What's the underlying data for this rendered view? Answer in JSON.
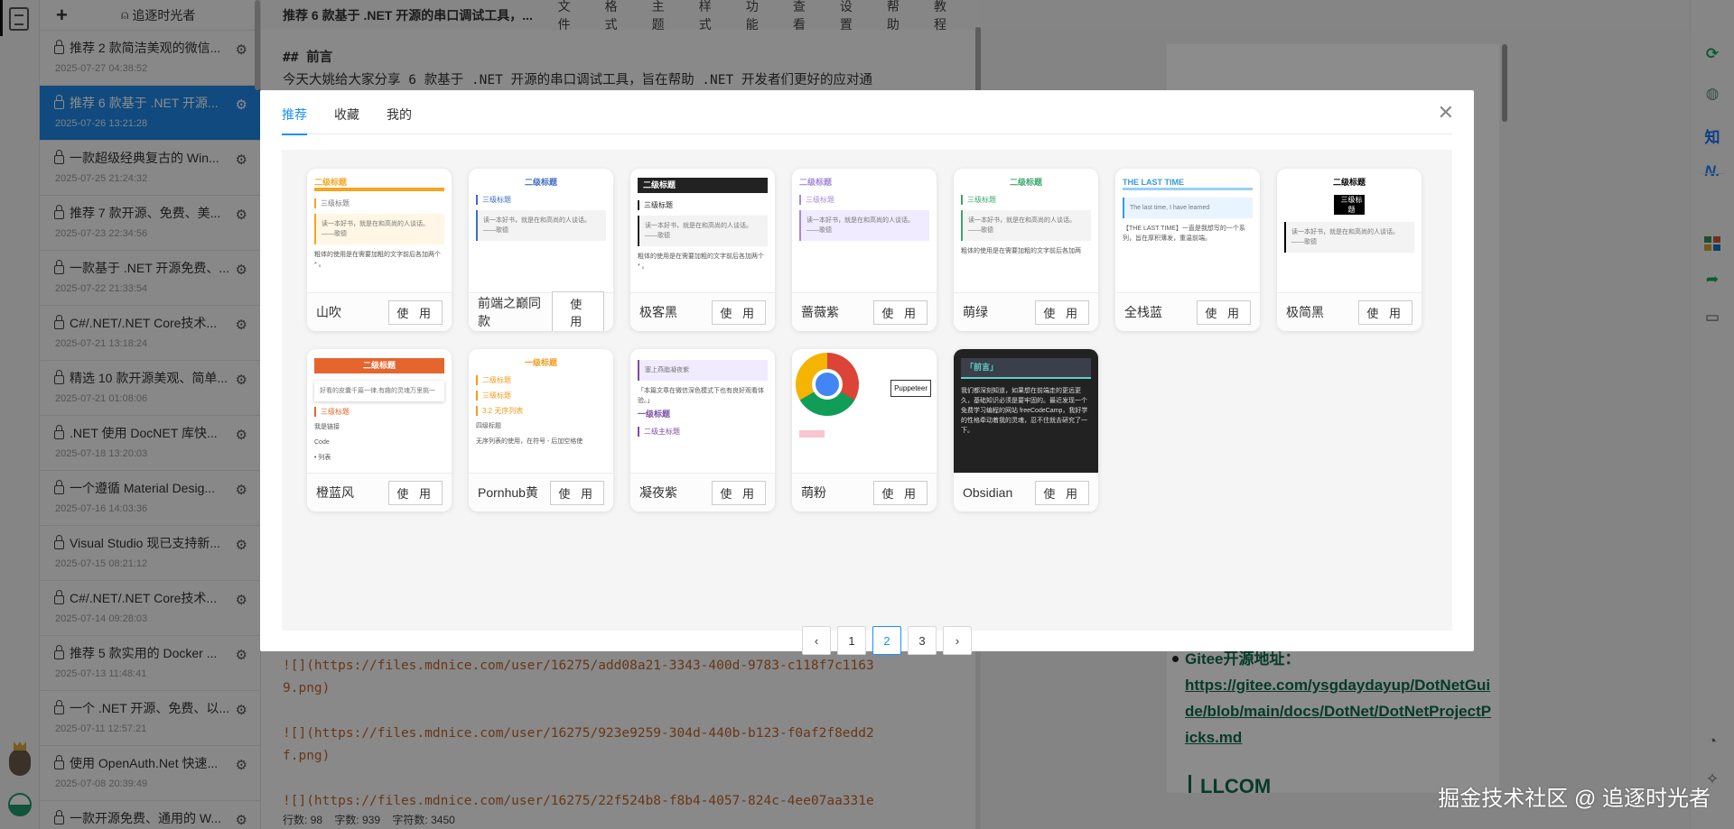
{
  "sidebar": {
    "new_label": "+",
    "author": "追逐时光者",
    "items": [
      {
        "title": "推荐 2 款简洁美观的微信...",
        "date": "2025-07-27 04:38:52"
      },
      {
        "title": "推荐 6 款基于 .NET 开源...",
        "date": "2025-07-26 13:21:28",
        "active": true
      },
      {
        "title": "一款超级经典复古的 Win...",
        "date": "2025-07-25 21:24:32"
      },
      {
        "title": "推荐 7 款开源、免费、美...",
        "date": "2025-07-23 22:34:56"
      },
      {
        "title": "一款基于 .NET 开源免费、...",
        "date": "2025-07-22 21:33:54"
      },
      {
        "title": "C#/.NET/.NET Core技术...",
        "date": "2025-07-21 13:18:24"
      },
      {
        "title": "精选 10 款开源美观、简单...",
        "date": "2025-07-21 01:08:06"
      },
      {
        "title": ".NET 使用 DocNET 库快...",
        "date": "2025-07-18 13:20:03"
      },
      {
        "title": "一个遵循 Material Desig...",
        "date": "2025-07-16 14:03:36"
      },
      {
        "title": "Visual Studio 现已支持新...",
        "date": "2025-07-15 08:21:12"
      },
      {
        "title": "C#/.NET/.NET Core技术...",
        "date": "2025-07-14 09:28:03"
      },
      {
        "title": "推荐 5 款实用的 Docker ...",
        "date": "2025-07-13 11:48:41"
      },
      {
        "title": "一个 .NET 开源、免费、以...",
        "date": "2025-07-11 12:57:21"
      },
      {
        "title": "使用 OpenAuth.Net 快速...",
        "date": "2025-07-08 20:39:49"
      },
      {
        "title": "一款开源免费、通用的 W...",
        "date": ""
      }
    ]
  },
  "editor": {
    "doc_title": "推荐 6 款基于 .NET 开源的串口调试工具，...",
    "menu": [
      "文件",
      "格式",
      "主题",
      "样式",
      "功能",
      "查看",
      "设置",
      "帮助",
      "教程"
    ],
    "heading": "## 前言",
    "paragraph": "今天大姚给大家分享 6 款基于 .NET 开源的串口调试工具，旨在帮助 .NET 开发者们更好的应对通",
    "image_lines": [
      [
        "![](https://files.mdnice.com/user/16275/add08a21-3343-400d-9783-c118f7c1163",
        "9.png)"
      ],
      [
        "![](https://files.mdnice.com/user/16275/923e9259-304d-440b-b123-f0af2f8edd2",
        "f.png)"
      ],
      [
        "![](https://files.mdnice.com/user/16275/22f524b8-f8b4-4057-824c-4ee07aa331e"
      ]
    ],
    "status": {
      "lines": "行数: 98",
      "words": "字数: 939",
      "chars": "字符数: 3450"
    }
  },
  "preview": {
    "gitee_label": "Gitee开源地址：",
    "gitee_url": "https://gitee.com/ysgdaydayup/DotNetGuide/blob/main/docs/DotNet/DotNetProjectPicks.md",
    "next_heading": "LLCOM"
  },
  "right_bar": {
    "zhihu": "知",
    "juejin": "N."
  },
  "watermark": "掘金技术社区 @ 追逐时光者",
  "modal": {
    "tabs": [
      "推荐",
      "收藏",
      "我的"
    ],
    "active_tab": 0,
    "use_label": "使 用",
    "themes": [
      {
        "name": "山吹",
        "accent": "#f5a623",
        "lines": [
          [
            "h2",
            "二级标题"
          ],
          [
            "h3",
            "三级标题"
          ],
          [
            "q",
            "读一本好书，就是在和高尚的人谈话。——歌德"
          ],
          [
            "b",
            "粗体的使用是在需要加粗的文字前后各加两个 * 。"
          ]
        ]
      },
      {
        "name": "前端之巅同款",
        "accent": "#3f6cc4",
        "lines": [
          [
            "h2",
            "二级标题"
          ],
          [
            "h3",
            "三级标题"
          ],
          [
            "q",
            "读一本好书，就是在和高尚的人谈话。——歌德"
          ]
        ]
      },
      {
        "name": "极客黑",
        "accent": "#222222",
        "lines": [
          [
            "h2",
            "二级标题"
          ],
          [
            "h3",
            "三级标题"
          ],
          [
            "q",
            "读一本好书，就是在和高尚的人谈话。——歌德"
          ],
          [
            "b",
            "粗体的使用是在需要加粗的文字前后各加两个 * 。"
          ]
        ]
      },
      {
        "name": "蔷薇紫",
        "accent": "#a58ad8",
        "lines": [
          [
            "h2",
            "二级标题"
          ],
          [
            "h3",
            "三级标题"
          ],
          [
            "q",
            "读一本好书，就是在和高尚的人谈话。——歌德"
          ]
        ]
      },
      {
        "name": "萌绿",
        "accent": "#3aa86b",
        "lines": [
          [
            "h2",
            "二级标题"
          ],
          [
            "h3",
            "三级标题"
          ],
          [
            "q",
            "读一本好书，就是在和高尚的人谈话。——歌德"
          ],
          [
            "b",
            "粗体的使用是在需要加粗的文字前后各加两"
          ]
        ]
      },
      {
        "name": "全栈蓝",
        "accent": "#3a9ad9",
        "lines": [
          [
            "h2",
            "THE LAST TIME"
          ],
          [
            "q",
            "The last time, I have learned"
          ],
          [
            "b",
            "【THE LAST TIME】一直是我想写的一个系列，旨在厚积薄发，重温前端。"
          ]
        ]
      },
      {
        "name": "极简黑",
        "accent": "#000000",
        "lines": [
          [
            "h2",
            "二级标题"
          ],
          [
            "h3",
            "三级标题"
          ],
          [
            "q",
            "读一本好书，就是在和高尚的人谈话。——歌德"
          ]
        ]
      },
      {
        "name": "橙蓝风",
        "accent": "#e5652e",
        "lines": [
          [
            "h2",
            "二级标题"
          ],
          [
            "q",
            "好看的皮囊千篇一律,有趣的灵魂万里挑一"
          ],
          [
            "h3",
            "三级标题"
          ],
          [
            "b",
            "我是链接"
          ],
          [
            "b",
            "Code"
          ],
          [
            "b",
            "• 列表"
          ]
        ]
      },
      {
        "name": "Pornhub黄",
        "accent": "#f59a1b",
        "lines": [
          [
            "h2",
            "一级标题"
          ],
          [
            "h3",
            "二级标题"
          ],
          [
            "h3",
            "三级标题"
          ],
          [
            "h3",
            "3.2 无序列表"
          ],
          [
            "b",
            "四级标题"
          ],
          [
            "b",
            "无序列表的使用，在符号 - 后加空格使"
          ]
        ]
      },
      {
        "name": "凝夜紫",
        "accent": "#7a4fa8",
        "lines": [
          [
            "q",
            "塞上燕脂凝夜紫"
          ],
          [
            "b",
            "「本篇文章在微信深色模式下也有良好观看体验。」"
          ],
          [
            "h2",
            "一级标题"
          ],
          [
            "h3",
            "二级主标题"
          ]
        ]
      },
      {
        "name": "萌粉",
        "accent": "#f08aa0",
        "lines": [
          [
            "b",
            "Puppeteer"
          ]
        ]
      },
      {
        "name": "Obsidian",
        "accent": "#5fd0c9",
        "lines": [
          [
            "h2",
            "「前言」"
          ],
          [
            "b",
            "我们都深刻知道，如果想在前端走的更远更久，基础知识必须是要牢固的。最近发现一个免费学习编程的网站 freeCodeCamp，我好学的性格牵动着我的灵魂，忍不住就去研究了一下。"
          ]
        ]
      }
    ],
    "pagination": {
      "prev": "‹",
      "pages": [
        "1",
        "2",
        "3"
      ],
      "current": "2",
      "next": "›"
    }
  }
}
